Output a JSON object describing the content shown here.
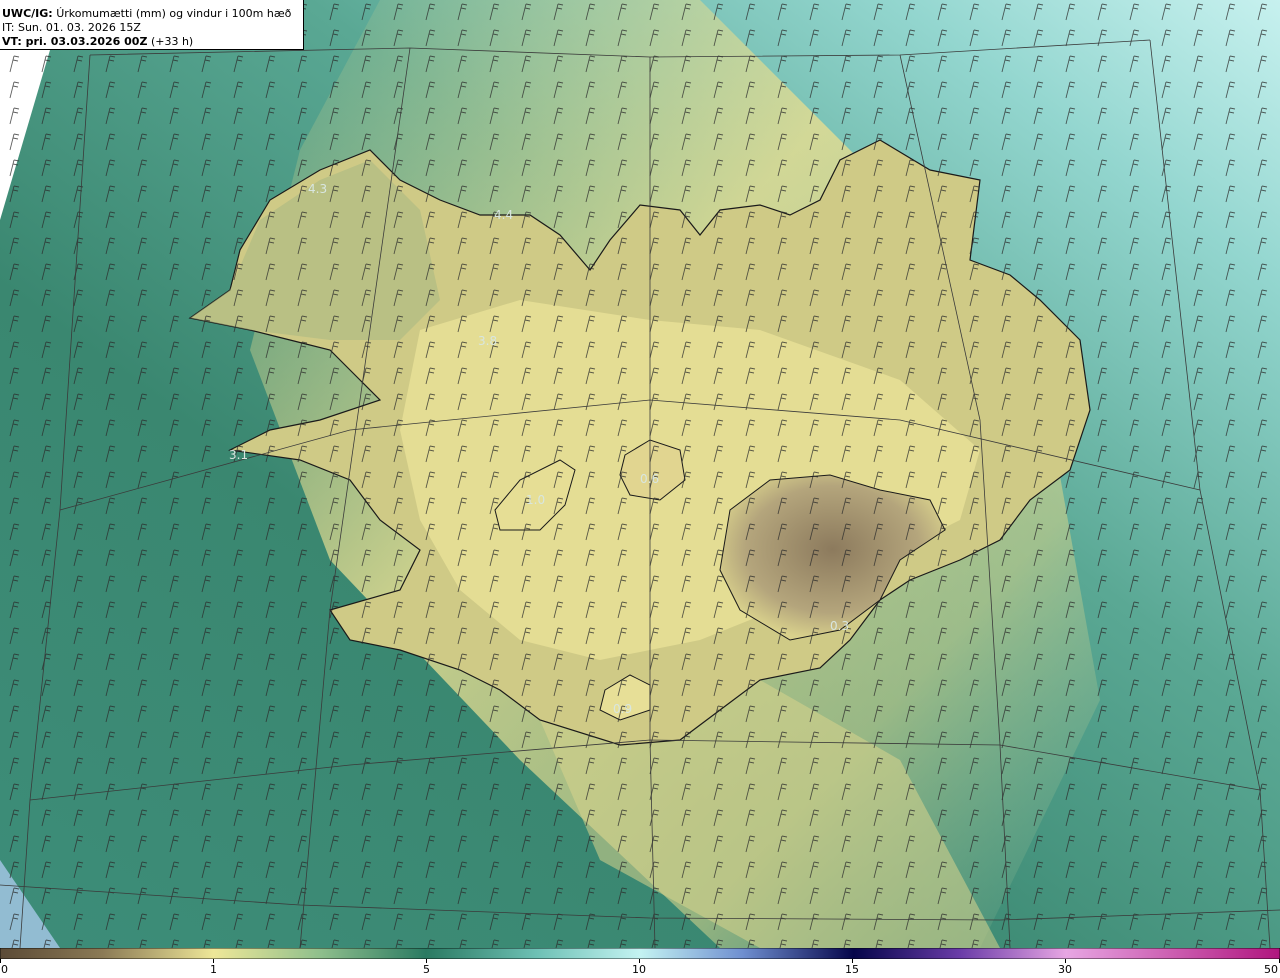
{
  "header": {
    "model": "UWC/IG:",
    "field": "Úrkomumætti (mm) og vindur i 100m hæð",
    "init_time": "IT: Sun. 01. 03. 2026 15Z",
    "valid_prefix": "VT: pri. 03.03.2026 00Z",
    "valid_suffix": "(+33 h)"
  },
  "colorbar": {
    "labels": [
      "0",
      "1",
      "5",
      "10",
      "15",
      "30",
      "50"
    ],
    "colors": [
      "#5b4a36",
      "#8b7a55",
      "#c9bf80",
      "#eee798",
      "#2a8a6a",
      "#b9f2f0",
      "#1e3f8f",
      "#05054a",
      "#8a3aa8",
      "#e58ad6",
      "#b0157e"
    ]
  },
  "map_labels": [
    "4.3",
    "4.4",
    "3.1",
    "3.8",
    "1.0",
    "0.6",
    "0.3",
    "0.9"
  ],
  "colors": {
    "sea_dark": "#2f7a66",
    "sea_teal": "#5fb3a4",
    "sea_cyan": "#a9e4df",
    "land_yellow": "#e6df93",
    "land_olive": "#8aa479",
    "glacier_brown": "#9c8a6e",
    "coast": "#1a1a1a"
  }
}
